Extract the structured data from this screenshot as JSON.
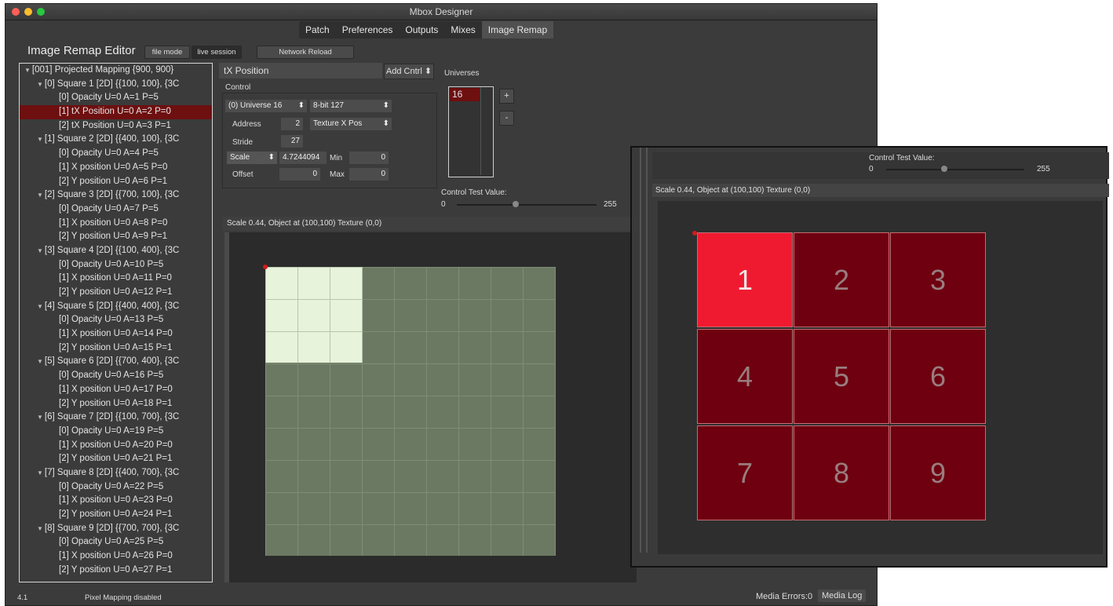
{
  "window": {
    "title": "Mbox Designer"
  },
  "tabs": [
    "Patch",
    "Preferences",
    "Outputs",
    "Mixes",
    "Image Remap"
  ],
  "editor": {
    "title": "Image Remap Editor",
    "file_mode": "file mode",
    "live_session": "live session",
    "network_reload": "Network Reload"
  },
  "tree": [
    {
      "level": 0,
      "label": "[001] Projected Mapping {900, 900}"
    },
    {
      "level": 1,
      "label": "[0] Square 1  [2D] {{100, 100}, {3C"
    },
    {
      "level": 2,
      "label": "[0] Opacity U=0 A=1 P=5"
    },
    {
      "level": 2,
      "label": "[1] tX Position U=0 A=2 P=0",
      "selected": true
    },
    {
      "level": 2,
      "label": "[2] tX Position U=0 A=3 P=1"
    },
    {
      "level": 1,
      "label": "[1] Square 2  [2D] {{400, 100}, {3C"
    },
    {
      "level": 2,
      "label": "[0] Opacity U=0 A=4 P=5"
    },
    {
      "level": 2,
      "label": "[1] X position U=0 A=5 P=0"
    },
    {
      "level": 2,
      "label": "[2] Y position U=0 A=6 P=1"
    },
    {
      "level": 1,
      "label": "[2] Square 3  [2D] {{700, 100}, {3C"
    },
    {
      "level": 2,
      "label": "[0] Opacity U=0 A=7 P=5"
    },
    {
      "level": 2,
      "label": "[1] X position U=0 A=8 P=0"
    },
    {
      "level": 2,
      "label": "[2] Y position U=0 A=9 P=1"
    },
    {
      "level": 1,
      "label": "[3] Square 4  [2D] {{100, 400}, {3C"
    },
    {
      "level": 2,
      "label": "[0] Opacity U=0 A=10 P=5"
    },
    {
      "level": 2,
      "label": "[1] X position U=0 A=11 P=0"
    },
    {
      "level": 2,
      "label": "[2] Y position U=0 A=12 P=1"
    },
    {
      "level": 1,
      "label": "[4] Square 5  [2D] {{400, 400}, {3C"
    },
    {
      "level": 2,
      "label": "[0] Opacity U=0 A=13 P=5"
    },
    {
      "level": 2,
      "label": "[1] X position U=0 A=14 P=0"
    },
    {
      "level": 2,
      "label": "[2] Y position U=0 A=15 P=1"
    },
    {
      "level": 1,
      "label": "[5] Square 6  [2D] {{700, 400}, {3C"
    },
    {
      "level": 2,
      "label": "[0] Opacity U=0 A=16 P=5"
    },
    {
      "level": 2,
      "label": "[1] X position U=0 A=17 P=0"
    },
    {
      "level": 2,
      "label": "[2] Y position U=0 A=18 P=1"
    },
    {
      "level": 1,
      "label": "[6] Square 7  [2D] {{100, 700}, {3C"
    },
    {
      "level": 2,
      "label": "[0] Opacity U=0 A=19 P=5"
    },
    {
      "level": 2,
      "label": "[1] X position U=0 A=20 P=0"
    },
    {
      "level": 2,
      "label": "[2] Y position U=0 A=21 P=1"
    },
    {
      "level": 1,
      "label": "[7] Square 8  [2D] {{400, 700}, {3C"
    },
    {
      "level": 2,
      "label": "[0] Opacity U=0 A=22 P=5"
    },
    {
      "level": 2,
      "label": "[1] X position U=0 A=23 P=0"
    },
    {
      "level": 2,
      "label": "[2] Y position U=0 A=24 P=1"
    },
    {
      "level": 1,
      "label": "[8] Square 9  [2D] {{700, 700}, {3C"
    },
    {
      "level": 2,
      "label": "[0] Opacity U=0 A=25 P=5"
    },
    {
      "level": 2,
      "label": "[1] X position U=0 A=26 P=0"
    },
    {
      "level": 2,
      "label": "[2] Y position U=0 A=27 P=1"
    }
  ],
  "control": {
    "header": "tX Position",
    "add_ctrl": "Add Cntrl",
    "section": "Control",
    "universe_select": "(0) Universe 16",
    "bit_select": "8-bit 127",
    "address_label": "Address",
    "address_value": "2",
    "texture_select": "Texture X Pos",
    "stride_label": "Stride",
    "stride_value": "27",
    "scale_select": "Scale",
    "scale_value": "4.7244094",
    "min_label": "Min",
    "min_value": "0",
    "offset_label": "Offset",
    "offset_value": "0",
    "max_label": "Max",
    "max_value": "0"
  },
  "universes": {
    "label": "Universes",
    "selected": "16",
    "add": "+",
    "remove": "-"
  },
  "test": {
    "label": "Control Test Value:",
    "min": "0",
    "max": "255",
    "value_fraction": 0.42
  },
  "canvas": {
    "header": "Scale 0.44, Object at (100,100) Texture (0,0)"
  },
  "status": {
    "version": "4.1",
    "pixel_mapping": "Pixel Mapping disabled",
    "media_errors": "Media Errors:0",
    "media_log": "Media Log"
  },
  "zoom": {
    "test_label": "Control Test Value:",
    "min": "0",
    "max": "255",
    "header": "Scale 0.44, Object at (100,100) Texture (0,0)",
    "squares": [
      "1",
      "2",
      "3",
      "4",
      "5",
      "6",
      "7",
      "8",
      "9"
    ]
  },
  "colors": {
    "selection": "#6e0f10",
    "highlight_square": "#f01a30",
    "square": "#6e0010"
  }
}
